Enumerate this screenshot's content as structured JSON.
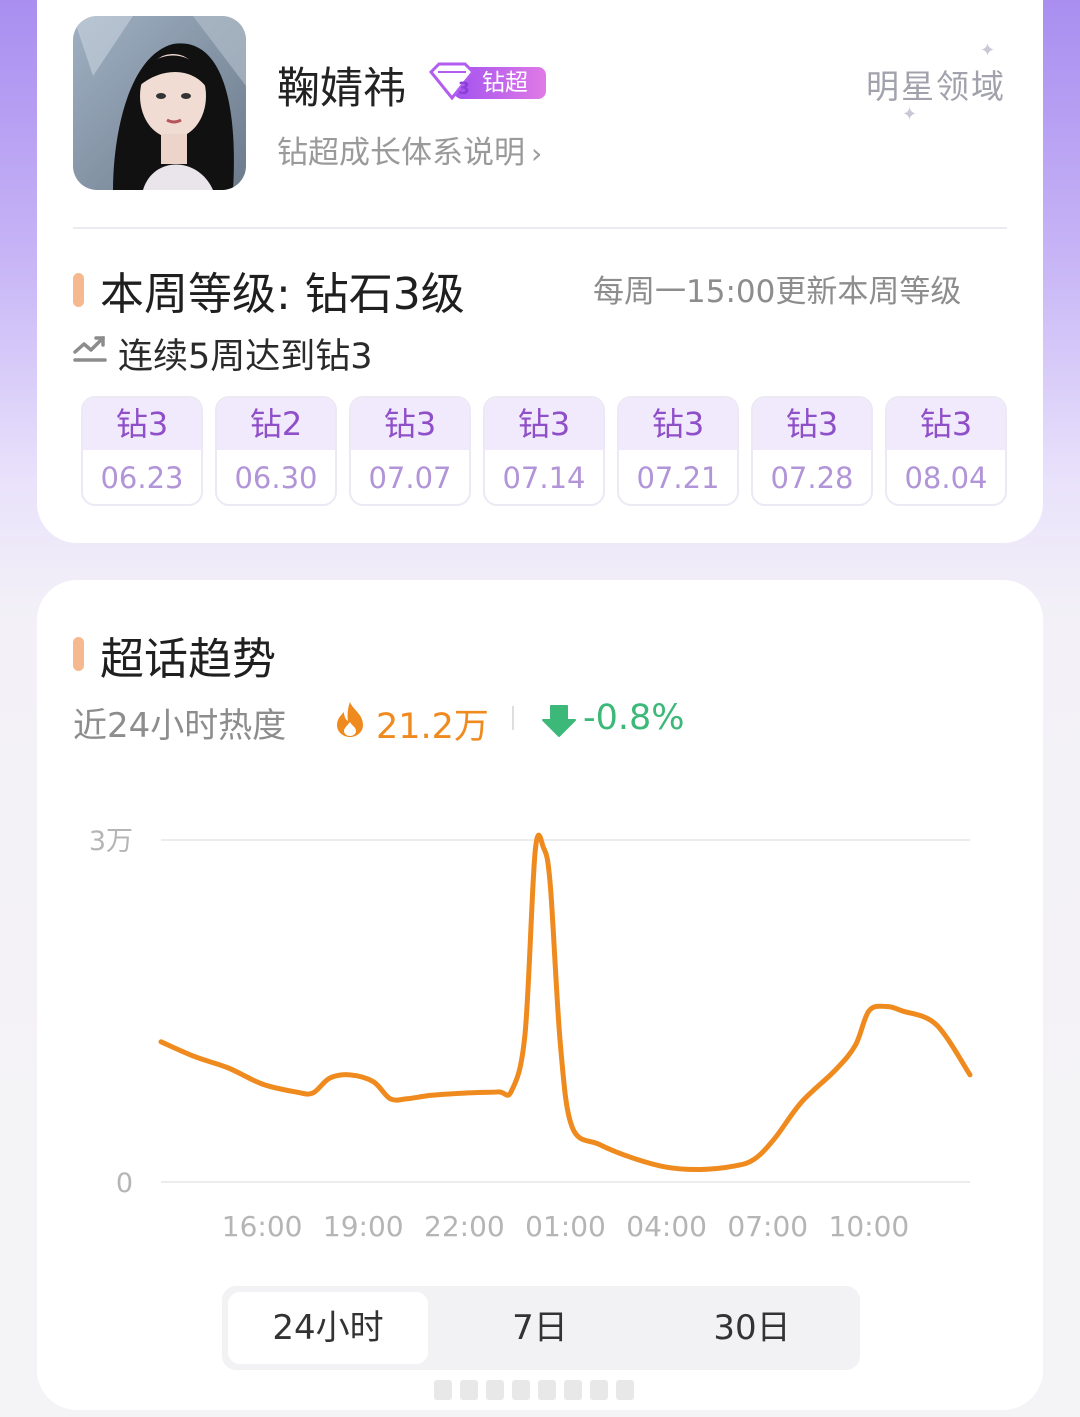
{
  "profile": {
    "name": "鞠婧祎",
    "badge_level": "3",
    "badge_label": "钻超",
    "growth_link": "钻超成长体系说明",
    "domain_logo": "明星领域"
  },
  "level": {
    "title": "本周等级: 钻石3级",
    "update_note": "每周一15:00更新本周等级",
    "streak": "连续5周达到钻3",
    "weeks": [
      {
        "level": "钻3",
        "date": "06.23"
      },
      {
        "level": "钻2",
        "date": "06.30"
      },
      {
        "level": "钻3",
        "date": "07.07"
      },
      {
        "level": "钻3",
        "date": "07.14"
      },
      {
        "level": "钻3",
        "date": "07.21"
      },
      {
        "level": "钻3",
        "date": "07.28"
      },
      {
        "level": "钻3",
        "date": "08.04"
      }
    ]
  },
  "trend": {
    "title": "超话趋势",
    "heat_label": "近24小时热度",
    "heat_value": "21.2万",
    "change": "-0.8%",
    "tabs": [
      {
        "label": "24小时",
        "active": true
      },
      {
        "label": "7日",
        "active": false
      },
      {
        "label": "30日",
        "active": false
      }
    ]
  },
  "colors": {
    "accent_purple": "#8f4fc8",
    "line_orange": "#ef8a1e",
    "down_green": "#3cb879",
    "section_bar": "#f6b98f"
  },
  "chart_data": {
    "type": "line",
    "y_tick_labels": [
      "0",
      "3万"
    ],
    "ylim": [
      0,
      30000
    ],
    "x_tick_labels": [
      "16:00",
      "19:00",
      "22:00",
      "01:00",
      "04:00",
      "07:00",
      "10:00"
    ],
    "xlim": [
      13,
      37
    ],
    "grid": true,
    "series": [
      {
        "color": "#ef8a1e",
        "points": [
          [
            13.0,
            12300
          ],
          [
            14.0,
            11000
          ],
          [
            15.0,
            10000
          ],
          [
            16.0,
            8600
          ],
          [
            17.0,
            7900
          ],
          [
            17.5,
            7800
          ],
          [
            18.0,
            9100
          ],
          [
            18.6,
            9400
          ],
          [
            19.3,
            8800
          ],
          [
            19.8,
            7300
          ],
          [
            20.3,
            7300
          ],
          [
            21.0,
            7600
          ],
          [
            22.0,
            7800
          ],
          [
            23.0,
            7900
          ],
          [
            23.4,
            8000
          ],
          [
            23.8,
            13000
          ],
          [
            24.1,
            29000
          ],
          [
            24.35,
            29300
          ],
          [
            24.55,
            26000
          ],
          [
            24.85,
            12000
          ],
          [
            25.2,
            4800
          ],
          [
            26.0,
            3300
          ],
          [
            27.0,
            2100
          ],
          [
            28.0,
            1300
          ],
          [
            29.0,
            1100
          ],
          [
            30.0,
            1400
          ],
          [
            30.6,
            2000
          ],
          [
            31.2,
            3800
          ],
          [
            32.0,
            7000
          ],
          [
            33.0,
            9800
          ],
          [
            33.6,
            12000
          ],
          [
            34.0,
            15000
          ],
          [
            34.5,
            15400
          ],
          [
            35.0,
            15000
          ],
          [
            36.0,
            13800
          ],
          [
            37.0,
            9400
          ]
        ]
      }
    ]
  }
}
